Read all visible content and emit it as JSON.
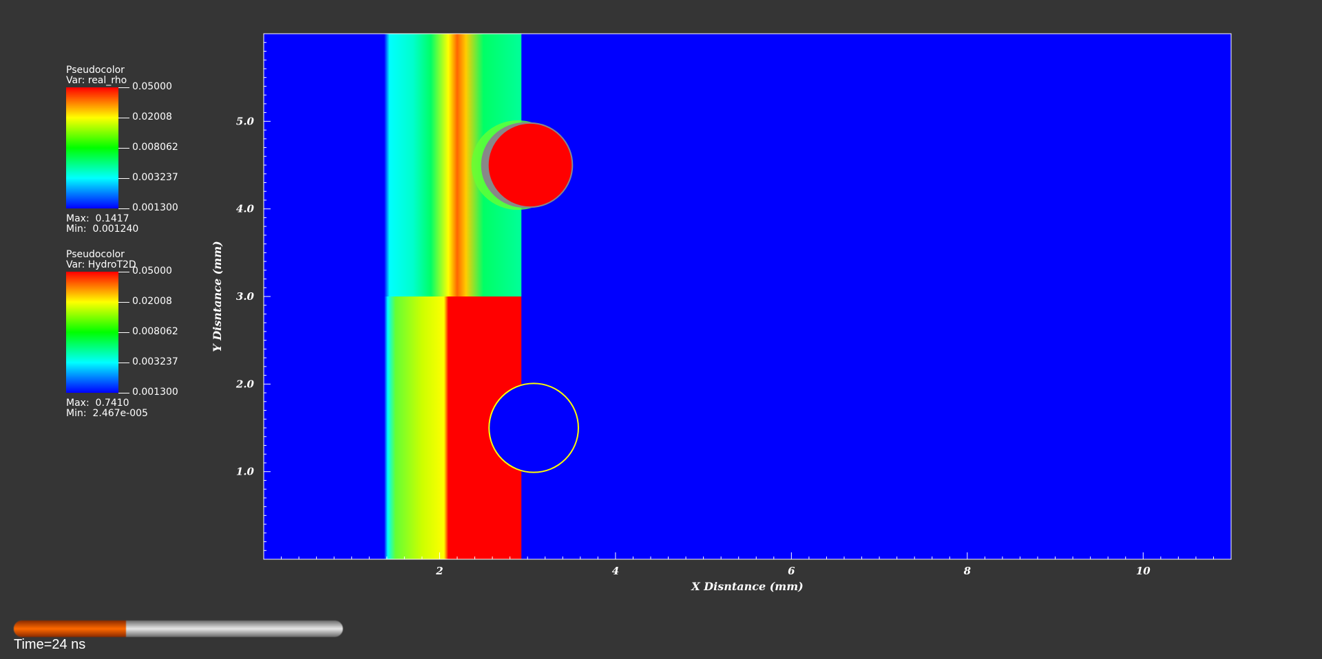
{
  "legends": [
    {
      "plot_type": "Pseudocolor",
      "var_line": "Var: real_rho",
      "ticks": [
        "0.05000",
        "0.02008",
        "0.008062",
        "0.003237",
        "0.001300"
      ],
      "max_line": "Max:  0.1417",
      "min_line": "Min:  0.001240"
    },
    {
      "plot_type": "Pseudocolor",
      "var_line": "Var: HydroT2D",
      "ticks": [
        "0.05000",
        "0.02008",
        "0.008062",
        "0.003237",
        "0.001300"
      ],
      "max_line": "Max:  0.7410",
      "min_line": "Min:  2.467e-005"
    }
  ],
  "time": {
    "label": "Time=24 ns",
    "progress_fraction": 0.34
  },
  "chart_data": {
    "type": "heatmap",
    "xlabel": "X Disntance (mm)",
    "ylabel": "Y Disntance (mm)",
    "xlim": [
      0,
      11
    ],
    "ylim": [
      0,
      6
    ],
    "xticks": [
      2,
      4,
      6,
      8,
      10
    ],
    "xtick_labels": [
      "2",
      "4",
      "6",
      "8",
      "10"
    ],
    "yticks": [
      1.0,
      2.0,
      3.0,
      4.0,
      5.0
    ],
    "ytick_labels": [
      "1.0",
      "2.0",
      "3.0",
      "4.0",
      "5.0"
    ],
    "colormap": [
      "#0000ff",
      "#00ffff",
      "#00ff00",
      "#ffff00",
      "#ff0000"
    ],
    "background_color": "#0000ff",
    "upper_region": {
      "field": "real_rho",
      "x_range": [
        1.37,
        2.93
      ],
      "y_range": [
        3.0,
        6.0
      ],
      "profile": [
        {
          "x": 1.37,
          "color": "#0000ff"
        },
        {
          "x": 1.43,
          "color": "#00ffff"
        },
        {
          "x": 1.7,
          "color": "#00ffcc"
        },
        {
          "x": 1.9,
          "color": "#00ff66"
        },
        {
          "x": 2.1,
          "color": "#ffff00"
        },
        {
          "x": 2.2,
          "color": "#ff6600"
        },
        {
          "x": 2.3,
          "color": "#ffcc00"
        },
        {
          "x": 2.5,
          "color": "#00ff66"
        },
        {
          "x": 2.93,
          "color": "#00ff99"
        }
      ]
    },
    "lower_region": {
      "field": "HydroT2D",
      "x_range": [
        1.37,
        2.93
      ],
      "y_range": [
        0.0,
        3.0
      ],
      "profile": [
        {
          "x": 1.37,
          "color": "#0000ff"
        },
        {
          "x": 1.41,
          "color": "#00ffff"
        },
        {
          "x": 1.5,
          "color": "#66ff33"
        },
        {
          "x": 1.8,
          "color": "#ccff00"
        },
        {
          "x": 2.05,
          "color": "#ffff00"
        },
        {
          "x": 2.1,
          "color": "#ff0000"
        },
        {
          "x": 2.93,
          "color": "#ff0000"
        }
      ]
    },
    "droplet_top": {
      "cx": 3.03,
      "cy": 4.5,
      "r": 0.48,
      "color": "#ff0000",
      "edge_color": "#888888"
    },
    "cavity_bottom": {
      "cx": 3.07,
      "cy": 1.5,
      "r": 0.5,
      "edge_color": "#ffff00"
    }
  }
}
